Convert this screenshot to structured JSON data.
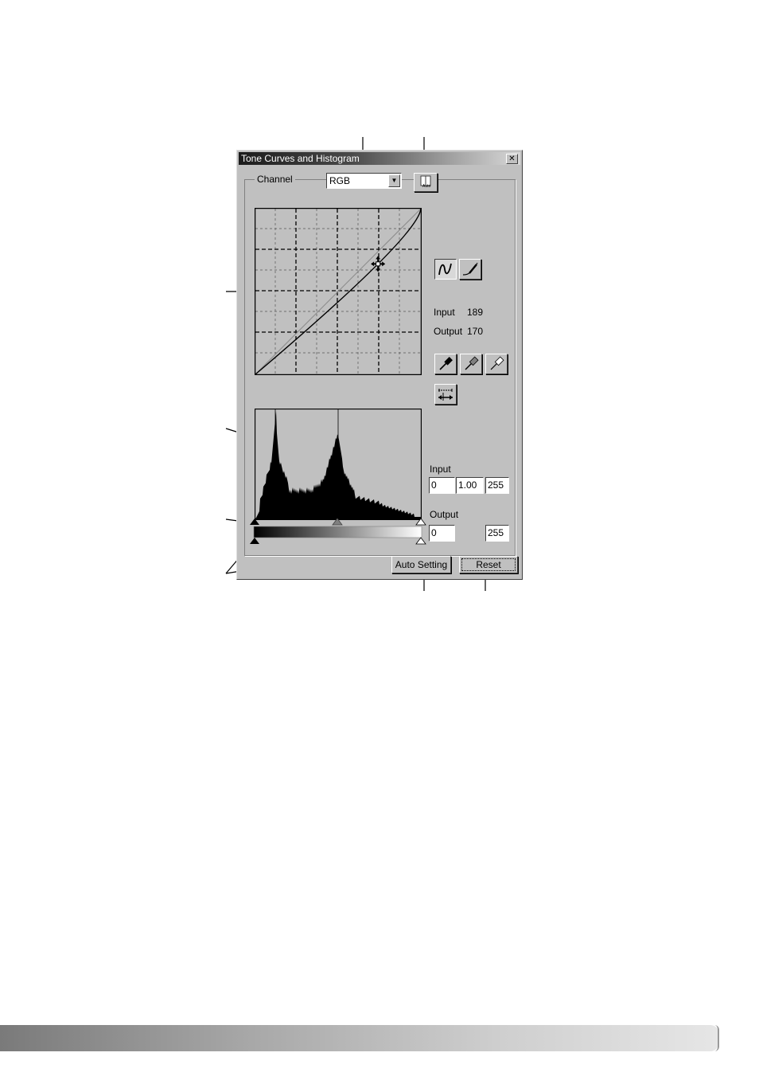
{
  "window": {
    "title": "Tone Curves and Histogram",
    "close_glyph": "✕"
  },
  "channel": {
    "label": "Channel",
    "selected": "RGB",
    "dropdown_glyph": "▼"
  },
  "auto_button_caption": "Auto",
  "readout": {
    "input_label": "Input",
    "input_value": "189",
    "output_label": "Output",
    "output_value": "170"
  },
  "levels": {
    "input_label": "Input",
    "input_black": "0",
    "input_gamma": "1.00",
    "input_white": "255",
    "output_label": "Output",
    "output_black": "0",
    "output_white": "255"
  },
  "buttons": {
    "auto_setting": "Auto Setting",
    "reset": "Reset"
  },
  "icons": [
    "close-icon",
    "chevron-down-icon",
    "auto-color-icon",
    "curve-tool-icon",
    "freehand-pencil-icon",
    "black-eyedropper-icon",
    "gray-eyedropper-icon",
    "white-eyedropper-icon",
    "move-cursor-icon",
    "levels-icon"
  ],
  "curve": {
    "control_point": {
      "input": 189,
      "output": 170
    }
  },
  "colors": {
    "dialog_face": "#c0c0c0",
    "title_bar_start": "#1b1b1b",
    "plot_bg": "#c0c0c0"
  }
}
